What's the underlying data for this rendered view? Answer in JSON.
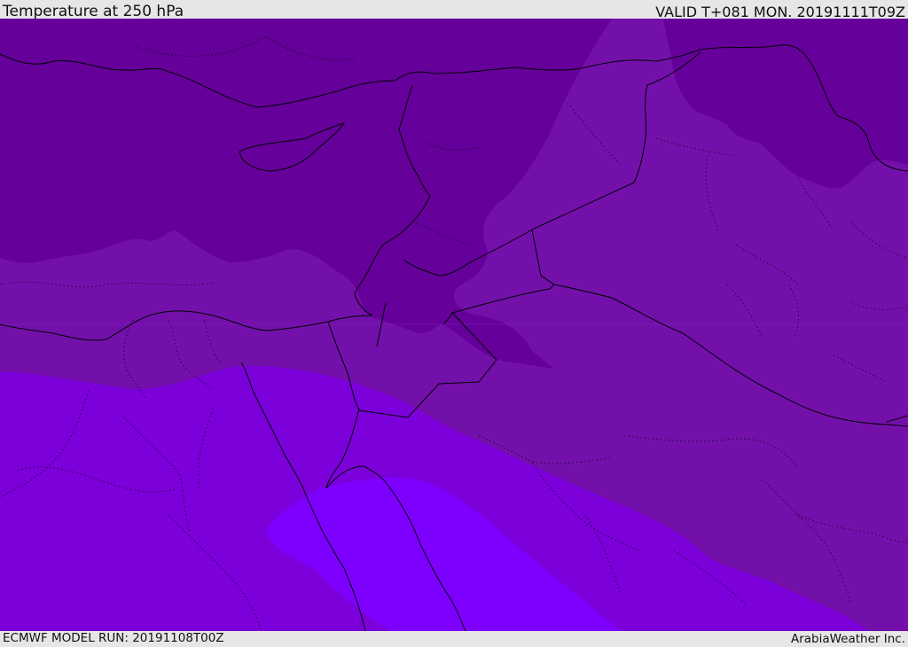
{
  "header": {
    "title": "Temperature at 250 hPa",
    "valid": "VALID T+081 MON. 20191111T09Z"
  },
  "footer": {
    "model_run": "ECMWF MODEL RUN: 20191108T00Z",
    "brand": "ArabiaWeather Inc."
  },
  "map": {
    "fill_colors": {
      "coldest": "#65009a",
      "cold": "#7310aa",
      "mild": "#7b00d9",
      "warm": "#7d00ff"
    },
    "line_color": "#000000"
  }
}
